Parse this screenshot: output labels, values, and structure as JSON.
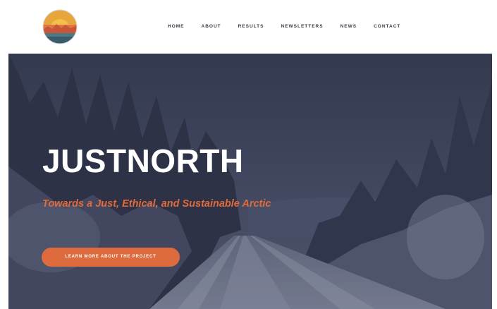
{
  "header": {
    "logo_icon": "justnorth-sunrise-logo-icon",
    "nav": [
      {
        "label": "HOME"
      },
      {
        "label": "ABOUT"
      },
      {
        "label": "RESULTS"
      },
      {
        "label": "NEWSLETTERS"
      },
      {
        "label": "NEWS"
      },
      {
        "label": "CONTACT"
      }
    ]
  },
  "hero": {
    "title": "JUSTNORTH",
    "subtitle": "Towards a Just, Ethical, and Sustainable Arctic",
    "cta_label": "LEARN MORE ABOUT THE PROJECT",
    "background_icon": "snowy-forest-road-photo"
  },
  "colors": {
    "accent": "#de6b3e",
    "subtitle": "#e06a3b",
    "hero_overlay": "#3b4257",
    "title_text": "#ffffff",
    "nav_text": "#333a45"
  }
}
